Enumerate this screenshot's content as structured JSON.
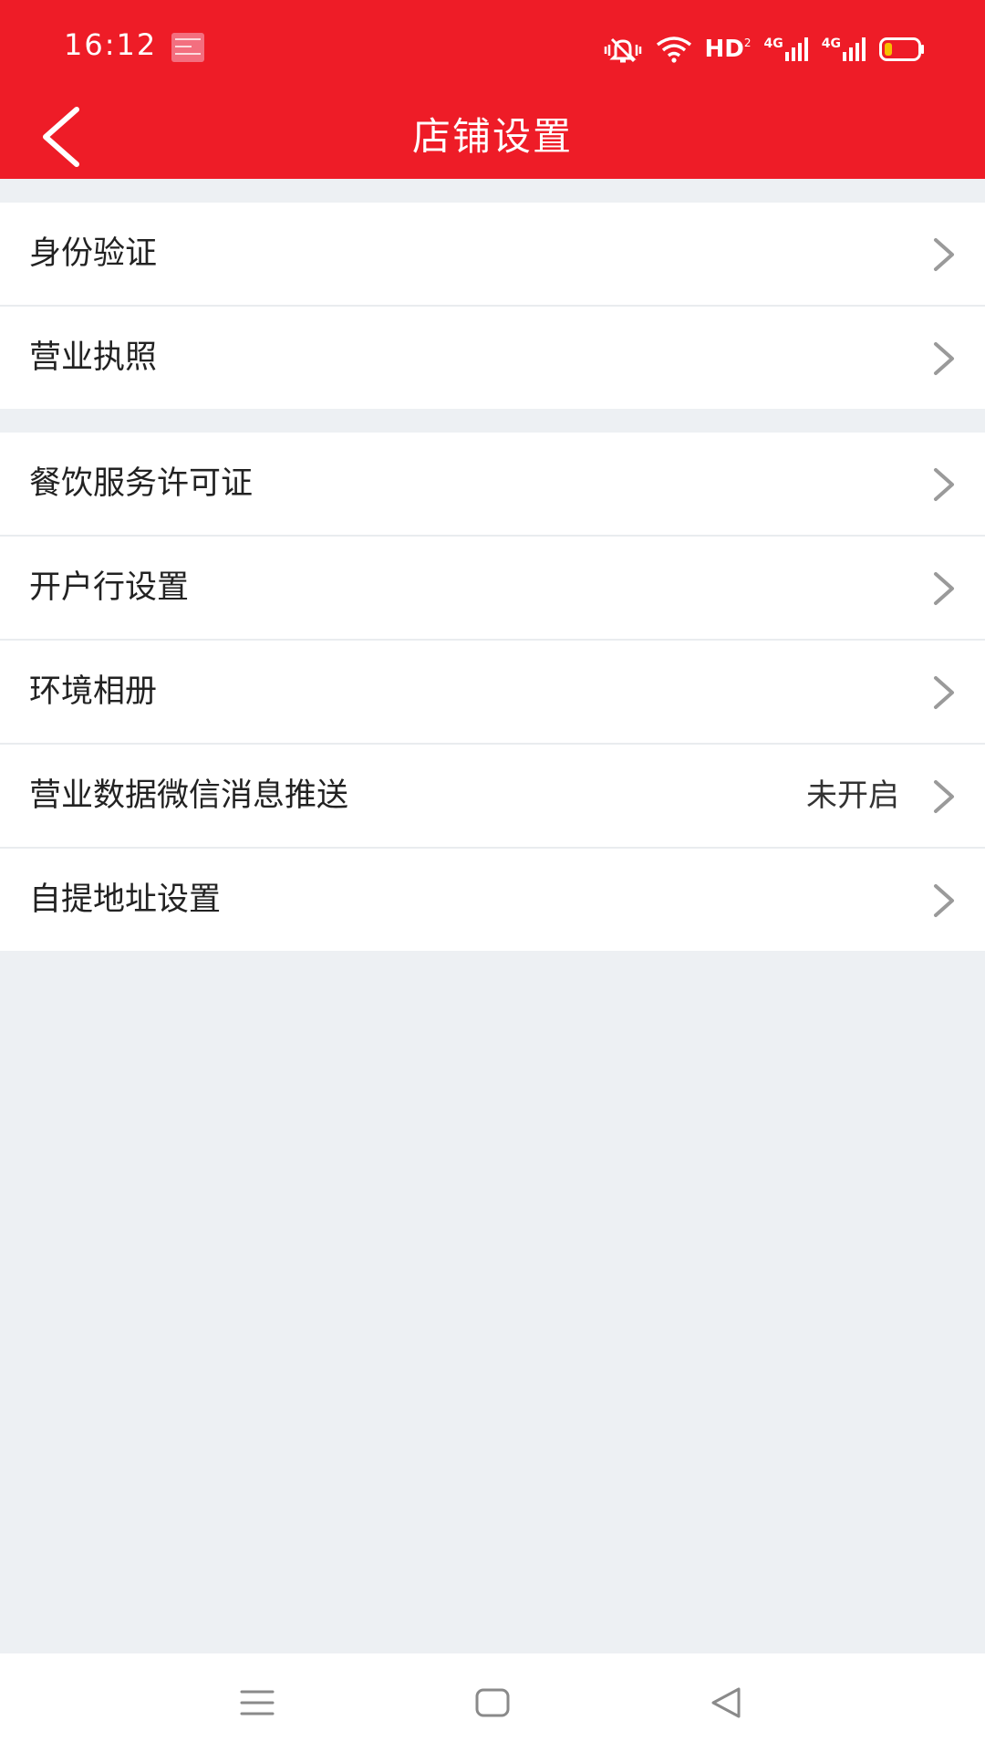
{
  "status_bar": {
    "time": "16:12",
    "hd_label": "HD",
    "hd_sub": "2",
    "network_1": "4G",
    "network_2": "4G"
  },
  "nav": {
    "title": "店铺设置"
  },
  "groups": [
    {
      "items": [
        {
          "label": "身份验证",
          "value": ""
        },
        {
          "label": "营业执照",
          "value": ""
        }
      ]
    },
    {
      "items": [
        {
          "label": "餐饮服务许可证",
          "value": ""
        },
        {
          "label": "开户行设置",
          "value": ""
        },
        {
          "label": "环境相册",
          "value": ""
        },
        {
          "label": "营业数据微信消息推送",
          "value": "未开启"
        },
        {
          "label": "自提地址设置",
          "value": ""
        }
      ]
    }
  ],
  "colors": {
    "header": "#ee1c27",
    "background": "#edf0f3",
    "chevron": "#9a9a9a"
  },
  "icons": {
    "back": "chevron-left-icon",
    "row": "chevron-right-icon",
    "sys_menu": "menu-icon",
    "sys_home": "home-icon",
    "sys_back": "back-triangle-icon"
  }
}
